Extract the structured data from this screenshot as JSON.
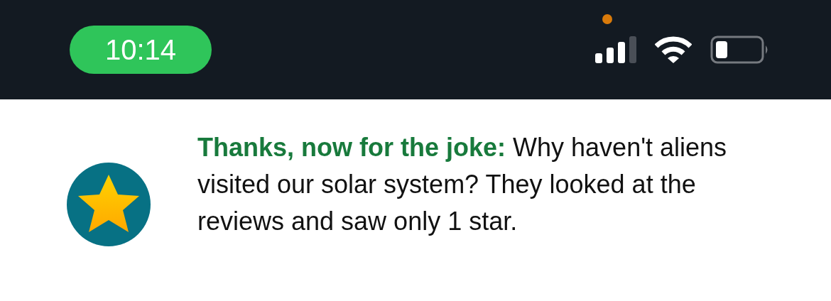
{
  "status_bar": {
    "time": "10:14"
  },
  "message": {
    "lead": "Thanks, now for the joke:",
    "text": "Why haven't aliens visited our solar system? They looked at the reviews and saw only 1 star."
  }
}
